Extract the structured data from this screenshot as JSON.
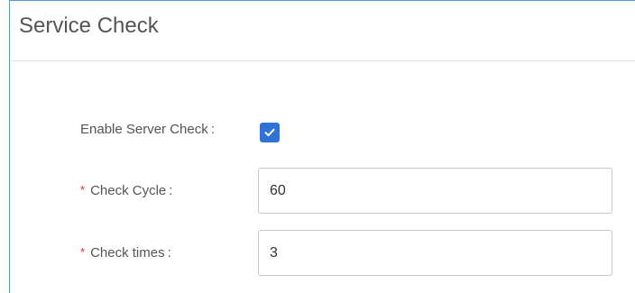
{
  "panel": {
    "title": "Service Check"
  },
  "form": {
    "enable_server_check": {
      "label": "Enable Server Check",
      "separator": ":",
      "checked": true
    },
    "check_cycle": {
      "required_mark": "*",
      "label": "Check Cycle",
      "separator": ":",
      "value": "60"
    },
    "check_times": {
      "required_mark": "*",
      "label": "Check times",
      "separator": ":",
      "value": "3"
    }
  },
  "colors": {
    "accent": "#2f73d6",
    "required": "#d9342b",
    "panel_border": "#5b9bd5"
  },
  "icons": {
    "checkbox_mark": "check-icon"
  }
}
